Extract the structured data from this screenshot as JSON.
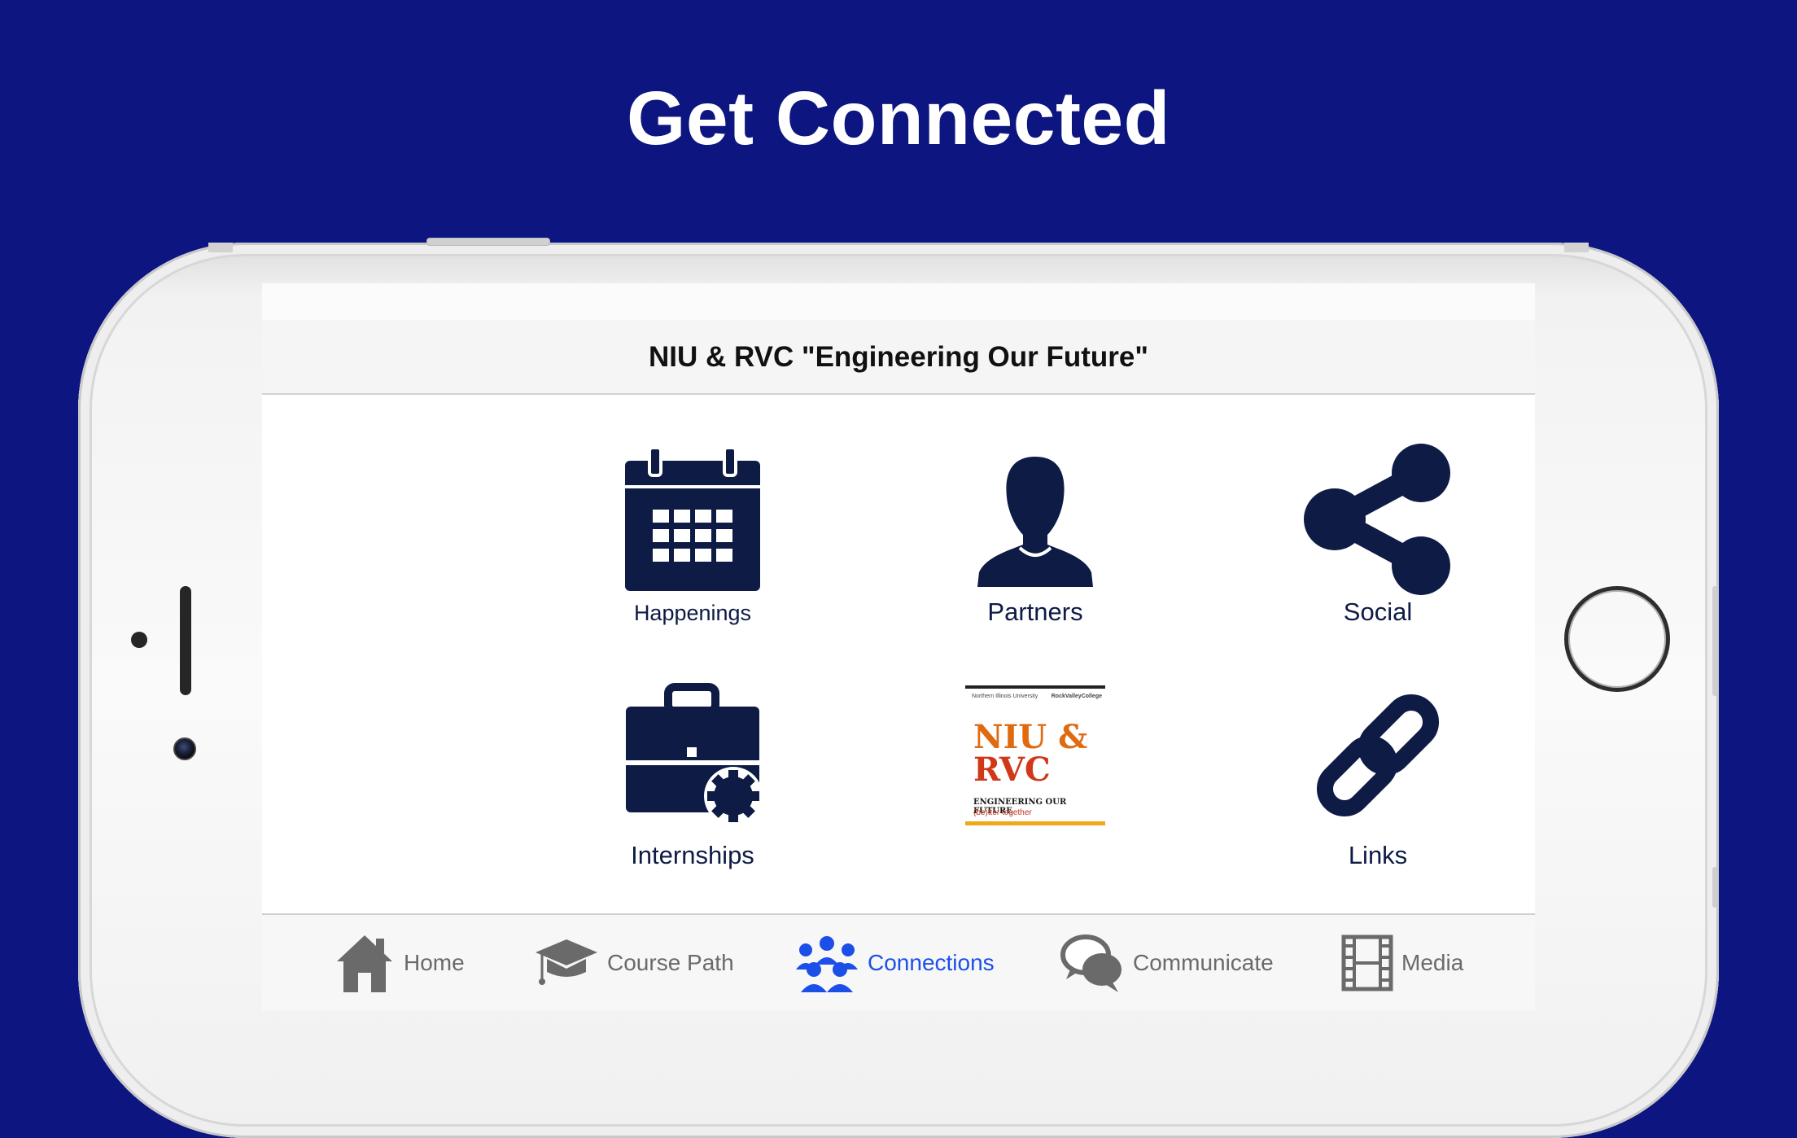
{
  "headline": "Get Connected",
  "colors": {
    "background": "#0c1580",
    "icon_navy": "#0d1b45",
    "active_tab": "#1c4fe8",
    "inactive_tab": "#6a6a6a"
  },
  "app": {
    "nav_title": "NIU & RVC \"Engineering Our Future\""
  },
  "tiles": [
    {
      "label": "Happenings",
      "icon": "calendar-icon"
    },
    {
      "label": "Partners",
      "icon": "person-icon"
    },
    {
      "label": "Social",
      "icon": "share-icon"
    },
    {
      "label": "Internships",
      "icon": "briefcase-icon"
    },
    {
      "label": "",
      "icon": "niu-rvc-logo"
    },
    {
      "label": "Links",
      "icon": "link-icon"
    }
  ],
  "logo": {
    "header_left": "Northern Illinois University",
    "header_right": "RockValleyCollege",
    "line1": "NIU &",
    "line2": "RVC",
    "tagline": "ENGINEERING OUR FUTURE",
    "subtagline": "(be)tter together"
  },
  "tabbar": {
    "items": [
      {
        "label": "Home",
        "icon": "home-icon",
        "active": false
      },
      {
        "label": "Course Path",
        "icon": "graduation-cap-icon",
        "active": false
      },
      {
        "label": "Connections",
        "icon": "people-icon",
        "active": true
      },
      {
        "label": "Communicate",
        "icon": "chat-bubbles-icon",
        "active": false
      },
      {
        "label": "Media",
        "icon": "film-icon",
        "active": false
      }
    ]
  }
}
